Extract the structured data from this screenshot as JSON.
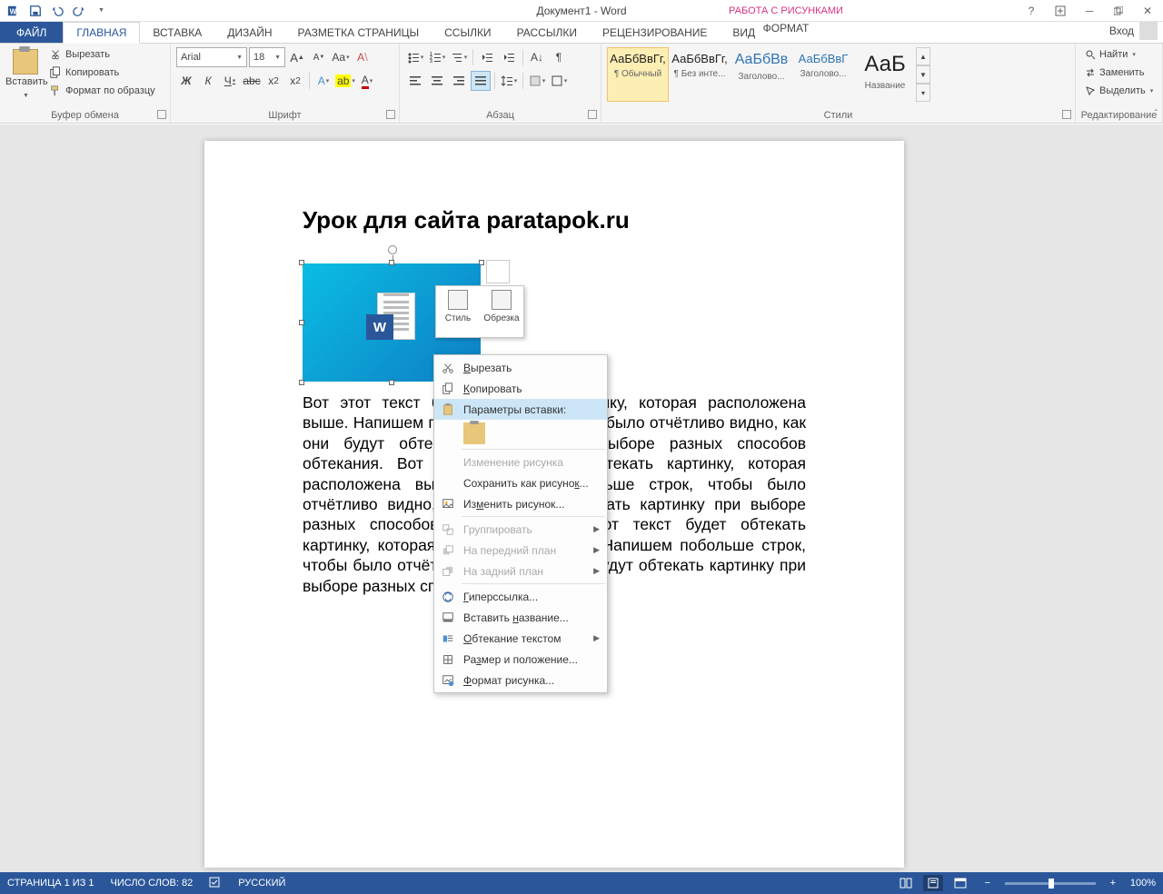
{
  "title": "Документ1 - Word",
  "picture_tools": "РАБОТА С РИСУНКАМИ",
  "login": "Вход",
  "tabs": {
    "file": "ФАЙЛ",
    "home": "ГЛАВНАЯ",
    "insert": "ВСТАВКА",
    "design": "ДИЗАЙН",
    "layout": "РАЗМЕТКА СТРАНИЦЫ",
    "references": "ССЫЛКИ",
    "mailings": "РАССЫЛКИ",
    "review": "РЕЦЕНЗИРОВАНИЕ",
    "view": "ВИД",
    "format": "ФОРМАТ"
  },
  "clipboard": {
    "paste": "Вставить",
    "cut": "Вырезать",
    "copy": "Копировать",
    "format_painter": "Формат по образцу",
    "label": "Буфер обмена"
  },
  "font": {
    "name": "Arial",
    "size": "18",
    "bold": "Ж",
    "italic": "К",
    "underline": "Ч",
    "label": "Шрифт"
  },
  "paragraph": {
    "label": "Абзац"
  },
  "styles": {
    "label": "Стили",
    "items": [
      {
        "preview": "АаБбВвГг,",
        "name": "¶ Обычный"
      },
      {
        "preview": "АаБбВвГг,",
        "name": "¶ Без инте..."
      },
      {
        "preview": "АаБбВв",
        "name": "Заголово..."
      },
      {
        "preview": "АаБбВвГ",
        "name": "Заголово..."
      },
      {
        "preview": "АаБ",
        "name": "Название"
      }
    ]
  },
  "editing": {
    "find": "Найти",
    "replace": "Заменить",
    "select": "Выделить",
    "label": "Редактирование"
  },
  "document": {
    "heading": "Урок для сайта paratapok.ru",
    "body": "Вот этот текст будет обтекать картинку, которая расположена выше. Напишем побольше строк, чтобы было отчётливо видно, как они будут обтекать картинку при выборе разных способов обтекания. Вот этот текст будет обтекать картинку, которая расположена выше. Напишем побольше строк, чтобы было отчётливо видно, как они будут обтекать картинку при выборе разных способов обтекания. Вот этот текст будет обтекать картинку, которая расположена выше. Напишем побольше строк, чтобы было отчётливо видно, как они будут обтекать картинку при выборе разных способов обтекания."
  },
  "mini": {
    "style": "Стиль",
    "crop": "Обрезка"
  },
  "context": {
    "cut": "Вырезать",
    "copy": "Копировать",
    "paste_options": "Параметры вставки:",
    "change_pic": "Изменение рисунка",
    "save_as_pic": "Сохранить как рисунок...",
    "edit_pic": "Изменить рисунок...",
    "group": "Группировать",
    "front": "На передний план",
    "back": "На задний план",
    "hyperlink": "Гиперссылка...",
    "insert_caption": "Вставить название...",
    "wrap_text": "Обтекание текстом",
    "size_pos": "Размер и положение...",
    "format_pic": "Формат рисунка..."
  },
  "status": {
    "page": "СТРАНИЦА 1 ИЗ 1",
    "words": "ЧИСЛО СЛОВ: 82",
    "lang": "РУССКИЙ",
    "zoom": "100%"
  }
}
